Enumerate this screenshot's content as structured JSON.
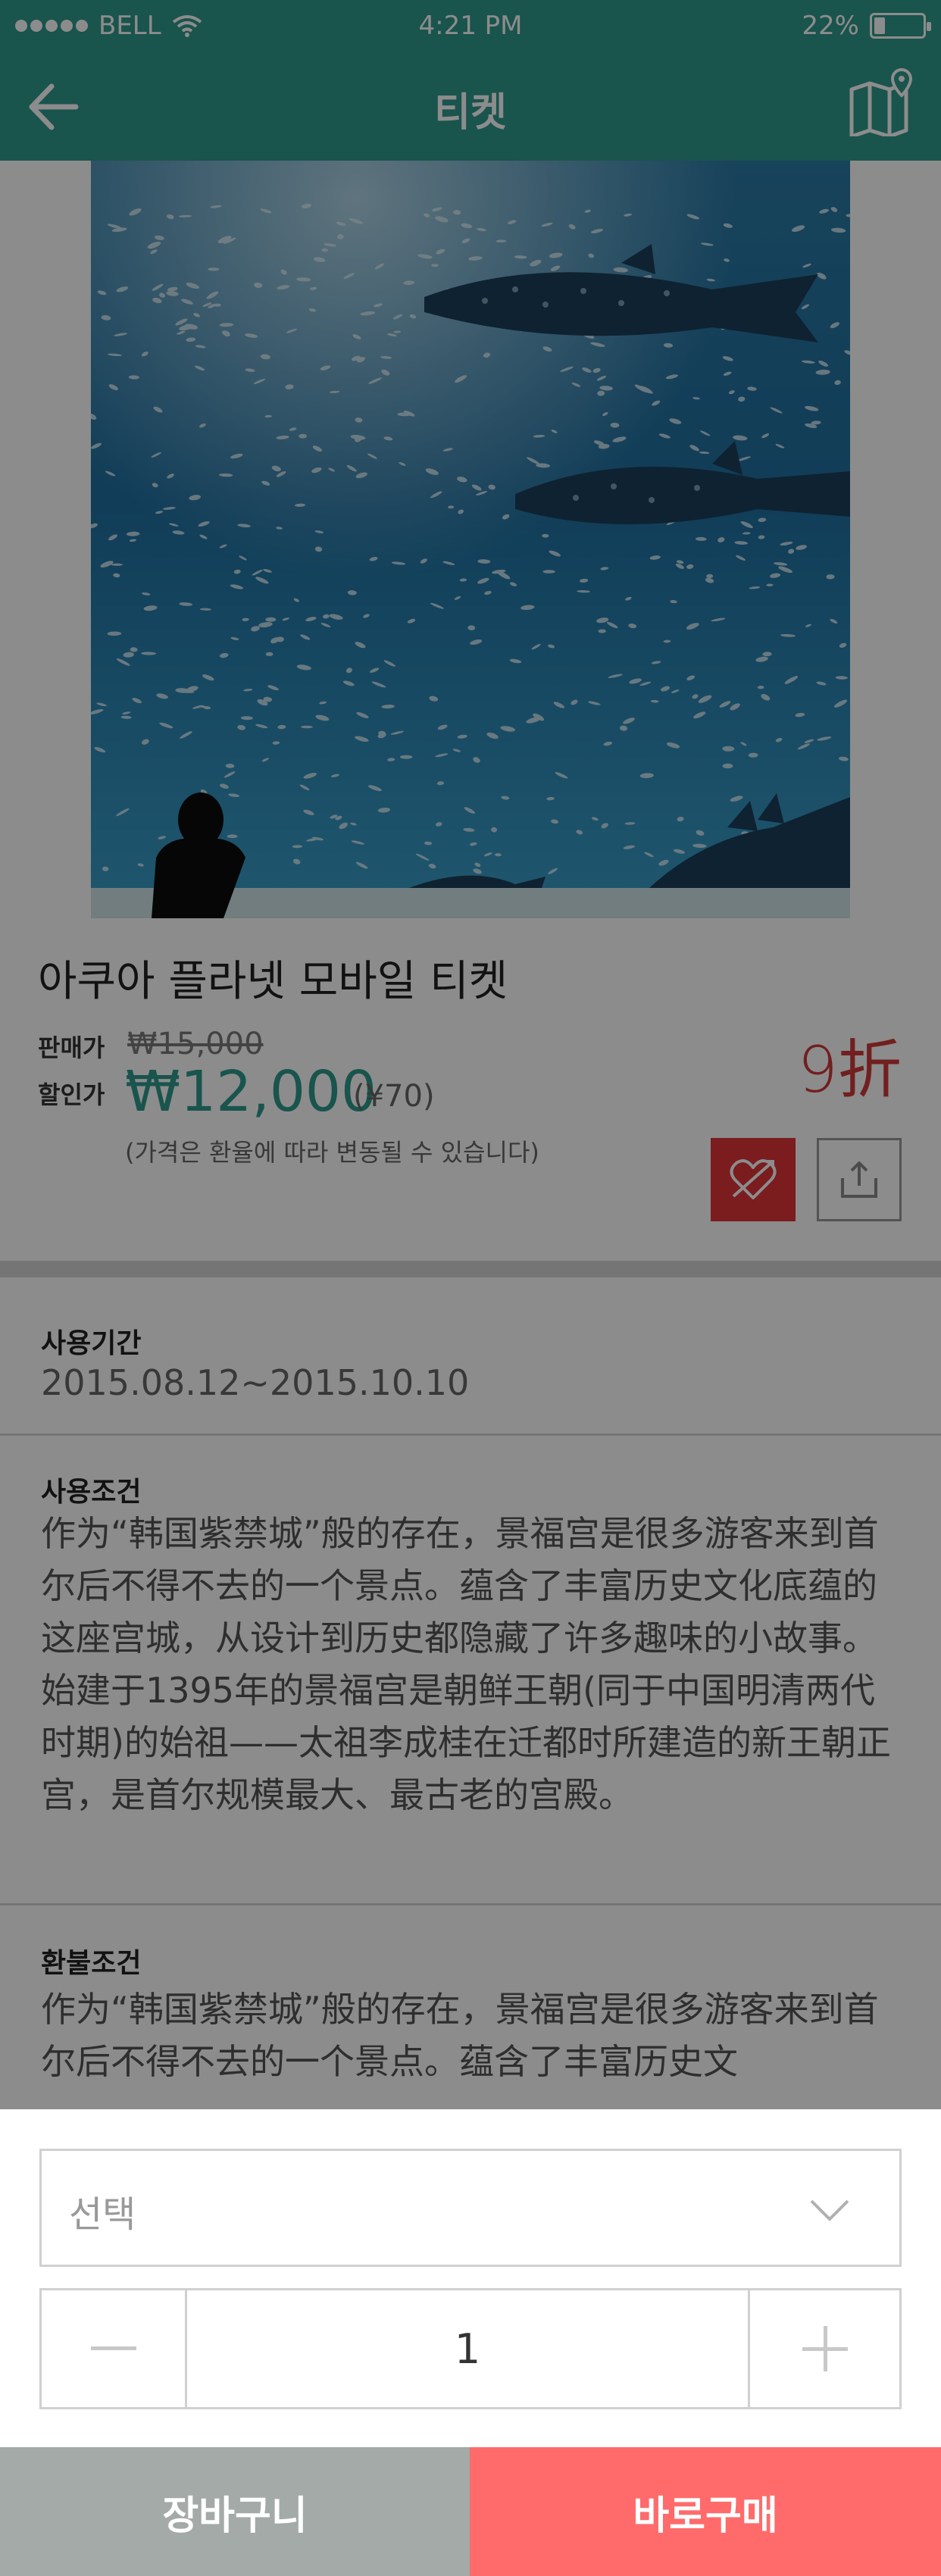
{
  "status_bar": {
    "carrier": "BELL",
    "time": "4:21 PM",
    "battery": "22%",
    "battery_level": 0.22
  },
  "nav": {
    "title": "티켓",
    "back_icon": "arrow-left-icon",
    "map_icon": "map-pin-icon"
  },
  "product": {
    "title": "아쿠아 플라넷 모바일 티켓",
    "list_price_label": "판매가",
    "list_price": "₩15,000",
    "sale_price_label": "할인가",
    "sale_price": "₩12,000",
    "sale_price_cny": "(¥70)",
    "price_note": "(가격은 환율에 따라 변동될 수 있습니다)",
    "discount": "9折"
  },
  "usage_period": {
    "label": "사용기간",
    "value": "2015.08.12~2015.10.10"
  },
  "usage_conditions": {
    "label": "사용조건",
    "text": "作为“韩国紫禁城”般的存在，景福宫是很多游客来到首尔后不得不去的一个景点。蕴含了丰富历史文化底蕴的这座宫城，从设计到历史都隐藏了许多趣味的小故事。\n始建于1395年的景福宫是朝鲜王朝(同于中国明清两代时期)的始祖——太祖李成桂在迁都时所建造的新王朝正宫，是首尔规模最大、最古老的宫殿。"
  },
  "refund_conditions": {
    "label": "환불조건",
    "text": "作为“韩国紫禁城”般的存在，景福宫是很多游客来到首尔后不得不去的一个景点。蕴含了丰富历史文"
  },
  "sheet": {
    "select_placeholder": "선택",
    "quantity": "1",
    "cart_label": "장바구니",
    "buy_label": "바로구매"
  },
  "colors": {
    "brand": "#2f9a8c",
    "discount_red": "#d03a3a",
    "like_red": "#e0343a",
    "buy_coral": "#ff6b6b",
    "cart_gray": "#a3aaa8"
  }
}
